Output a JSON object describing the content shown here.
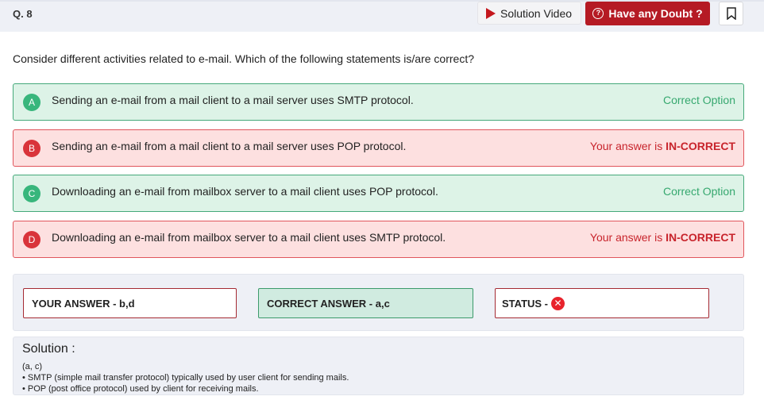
{
  "header": {
    "question_number": "Q. 8",
    "solution_video_label": "Solution Video",
    "doubt_label": "Have any Doubt ?"
  },
  "question": {
    "text": "Consider different activities related to e-mail. Which of the following statements is/are correct?"
  },
  "options": [
    {
      "letter": "A",
      "text": "Sending an e-mail from a mail client to a mail server uses SMTP protocol.",
      "status": "Correct Option",
      "state": "correct"
    },
    {
      "letter": "B",
      "text": "Sending an e-mail from a mail client to a mail server uses POP protocol.",
      "status_prefix": "Your answer is ",
      "status_strong": "IN-CORRECT",
      "state": "wrong"
    },
    {
      "letter": "C",
      "text": "Downloading an e-mail from mailbox server to a mail client uses POP protocol.",
      "status": "Correct Option",
      "state": "correct"
    },
    {
      "letter": "D",
      "text": "Downloading an e-mail from mailbox server to a mail client uses SMTP protocol.",
      "status_prefix": "Your answer is ",
      "status_strong": "IN-CORRECT",
      "state": "wrong"
    }
  ],
  "answers": {
    "your_answer": "YOUR ANSWER - b,d",
    "correct_answer": "CORRECT ANSWER - a,c",
    "status_label": "STATUS -",
    "status_icon": "x-circle-icon"
  },
  "solution": {
    "title": "Solution :",
    "lines": [
      "(a, c)",
      "• SMTP (simple mail transfer protocol) typically used by user client for sending mails.",
      "• POP (post office protocol) used by client for receiving mails."
    ]
  },
  "colors": {
    "correct_bg": "#ddf3e7",
    "correct_border": "#45a97a",
    "wrong_bg": "#fde0e0",
    "wrong_border": "#e0555c",
    "doubt_button": "#b51a24"
  }
}
